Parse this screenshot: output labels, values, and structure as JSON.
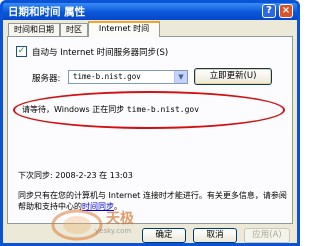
{
  "window": {
    "title": "日期和时间 属性",
    "help_label": "?",
    "close_label": "×"
  },
  "tabs": [
    {
      "label": "时间和日期",
      "active": false
    },
    {
      "label": "时区",
      "active": false
    },
    {
      "label": "Internet 时间",
      "active": true
    }
  ],
  "sync": {
    "checkbox_checked": true,
    "checkbox_mark": "✓",
    "auto_sync_label": "自动与 Internet 时间服务器同步(S)",
    "server_label": "服务器:",
    "server_value": "time-b.nist.gov",
    "update_button": "立即更新(U)"
  },
  "status": {
    "message_prefix": "请等待，Windows 正在同步",
    "message_server": "time-b.nist.gov"
  },
  "next_sync": {
    "text": "下次同步: 2008-2-23 在 13:03"
  },
  "info": {
    "text": "同步只有在您的计算机与 Internet 连接时才能进行。有关更多信息，请参阅帮助和支持中心的",
    "link": "时间同步",
    "end": "。"
  },
  "watermark": {
    "logo": "天极",
    "url": "yesky.com"
  },
  "buttons": {
    "ok": "确定",
    "cancel": "取消",
    "apply": "应用(A)"
  },
  "colors": {
    "titlebar_blue": "#0a57d9",
    "ellipse_red": "#d11111",
    "link_blue": "#0000cc"
  }
}
